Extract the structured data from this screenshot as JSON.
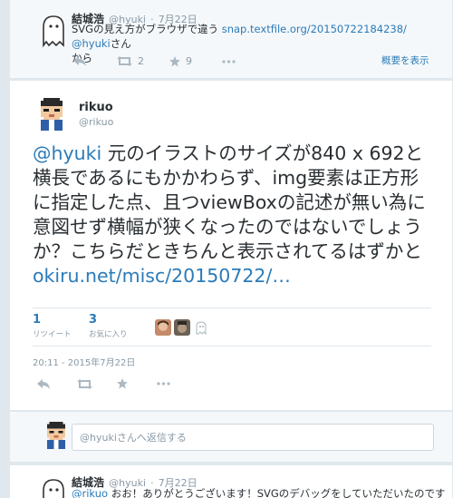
{
  "top_tweet": {
    "name": "結城浩",
    "handle": "@hyuki",
    "date": "7月22日",
    "text_prefix": "SVGの見え方がブラウザで違う",
    "link": "snap.textfile.org/20150722184238/",
    "mention": "@hyuki",
    "text_suffix_1": "さん",
    "text_suffix_2": "から",
    "retweet_count": "2",
    "favorite_count": "9",
    "details_label": "概要を表示"
  },
  "main_tweet": {
    "name": "rikuo",
    "handle": "@rikuo",
    "mention": "@hyuki",
    "text": " 元のイラストのサイズが840 x 692と横長であるにもかかわらず、img要素は正方形に指定した点、且つviewBoxの記述が無い為に意図せず横幅が狭くなったのではないでしょうか？こちらだときちんと表示されてるはずかと",
    "link": "okiru.net/misc/20150722/…",
    "retweets": "1",
    "retweets_label": "リツイート",
    "favorites": "3",
    "favorites_label": "お気に入り",
    "timestamp": "20:11 - 2015年7月22日"
  },
  "reply": {
    "placeholder": "@hyukiさんへ返信する"
  },
  "bottom_tweet": {
    "name": "結城浩",
    "handle": "@hyuki",
    "date": "7月22日",
    "mention": "@rikuo",
    "text": " おお！ありがとうございます！SVGのデバッグをしていただいたのです"
  },
  "icons": [
    "ghost-avatar",
    "pixel-avatar",
    "reply-icon",
    "retweet-icon",
    "favorite-icon",
    "more-icon",
    "add-face-icon"
  ],
  "colors": {
    "link": "#2b7bb9",
    "muted": "#8899a6",
    "background": "#e1e8ed"
  }
}
